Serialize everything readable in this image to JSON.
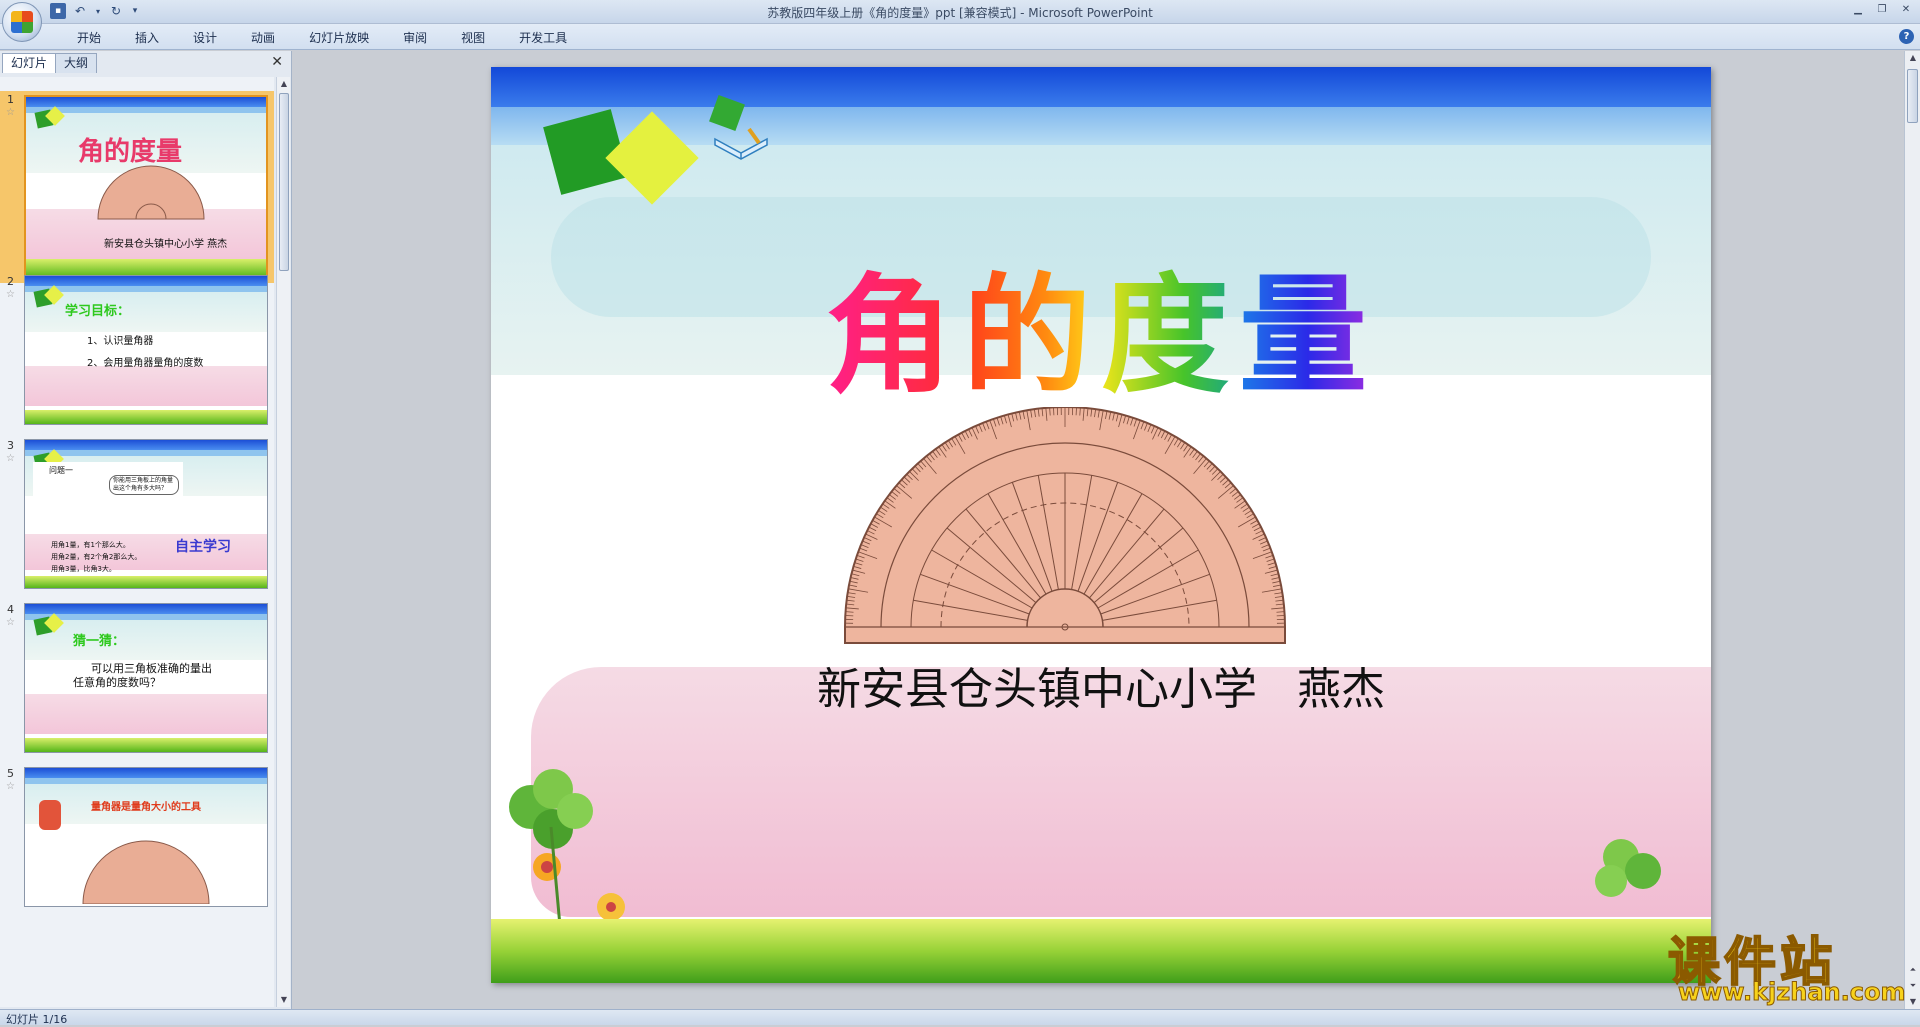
{
  "app": {
    "window_title": "苏教版四年级上册《角的度量》ppt [兼容模式] - Microsoft PowerPoint"
  },
  "ribbon": {
    "tabs": [
      "开始",
      "插入",
      "设计",
      "动画",
      "幻灯片放映",
      "审阅",
      "视图",
      "开发工具"
    ]
  },
  "left_panel": {
    "tabs": [
      "幻灯片",
      "大纲"
    ],
    "slides": [
      {
        "number": "1",
        "title": "角的度量",
        "subtitle": "新安县仓头镇中心小学  燕杰"
      },
      {
        "number": "2",
        "heading": "学习目标：",
        "lines": [
          "1、认识量角器",
          "2、会用量角器量角的度数"
        ]
      },
      {
        "number": "3",
        "label": "问题一",
        "bubble": "你能用三角板上的角量出这个角有多大吗？",
        "heading": "自主学习",
        "lines": [
          "用角1量，有1个那么大。",
          "用角2量，有2个角2那么大。",
          "用角3量，比角3大。"
        ]
      },
      {
        "number": "4",
        "heading": "猜一猜：",
        "lines": [
          "可以用三角板准确的量出",
          "任意角的度数吗？"
        ]
      },
      {
        "number": "5",
        "heading": "量角器是量角大小的工具"
      }
    ]
  },
  "slide": {
    "title_chars": [
      "角",
      "的",
      "度",
      "量"
    ],
    "author_school": "新安县仓头镇中心小学",
    "author_name": "燕杰"
  },
  "statusbar": {
    "slide_indicator": "幻灯片 1/16"
  },
  "watermark": {
    "main": "课件站",
    "url": "www.kjzhan.com"
  }
}
